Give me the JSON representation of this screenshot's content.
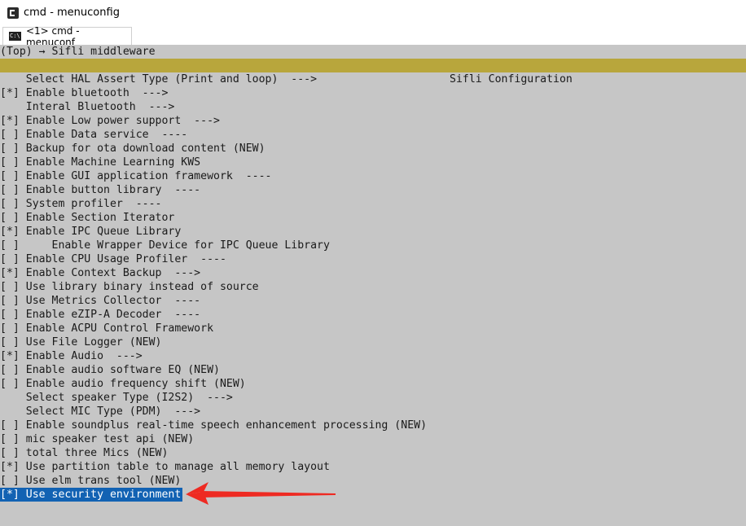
{
  "window": {
    "title": "cmd - menuconfig"
  },
  "tab": {
    "label": "<1> cmd - menuconf",
    "icon": "C:\\"
  },
  "terminal": {
    "breadcrumb": "(Top) → Sifli middleware",
    "header": "Sifli Configuration",
    "items": [
      "    Select HAL Assert Type (Print and loop)  --->",
      "[*] Enable bluetooth  --->",
      "    Interal Bluetooth  --->",
      "[*] Enable Low power support  --->",
      "[ ] Enable Data service  ----",
      "[ ] Backup for ota download content (NEW)",
      "[ ] Enable Machine Learning KWS",
      "[ ] Enable GUI application framework  ----",
      "[ ] Enable button library  ----",
      "[ ] System profiler  ----",
      "[ ] Enable Section Iterator",
      "[*] Enable IPC Queue Library",
      "[ ]     Enable Wrapper Device for IPC Queue Library",
      "[ ] Enable CPU Usage Profiler  ----",
      "[*] Enable Context Backup  --->",
      "[ ] Use library binary instead of source",
      "[ ] Use Metrics Collector  ----",
      "[ ] Enable eZIP-A Decoder  ----",
      "[ ] Enable ACPU Control Framework",
      "[ ] Use File Logger (NEW)",
      "[*] Enable Audio  --->",
      "[ ] Enable audio software EQ (NEW)",
      "[ ] Enable audio frequency shift (NEW)",
      "    Select speaker Type (I2S2)  --->",
      "    Select MIC Type (PDM)  --->",
      "[ ] Enable soundplus real-time speech enhancement processing (NEW)",
      "[ ] mic speaker test api (NEW)",
      "[ ] total three Mics (NEW)",
      "[*] Use partition table to manage all memory layout",
      "[ ] Use elm trans tool (NEW)"
    ],
    "selected_item": "[*] Use security environment"
  },
  "colors": {
    "terminal_bg": "#c6c6c6",
    "header_bg": "#b8a63c",
    "selection_bg": "#1262b3",
    "annotation_arrow": "#ee2a22"
  }
}
